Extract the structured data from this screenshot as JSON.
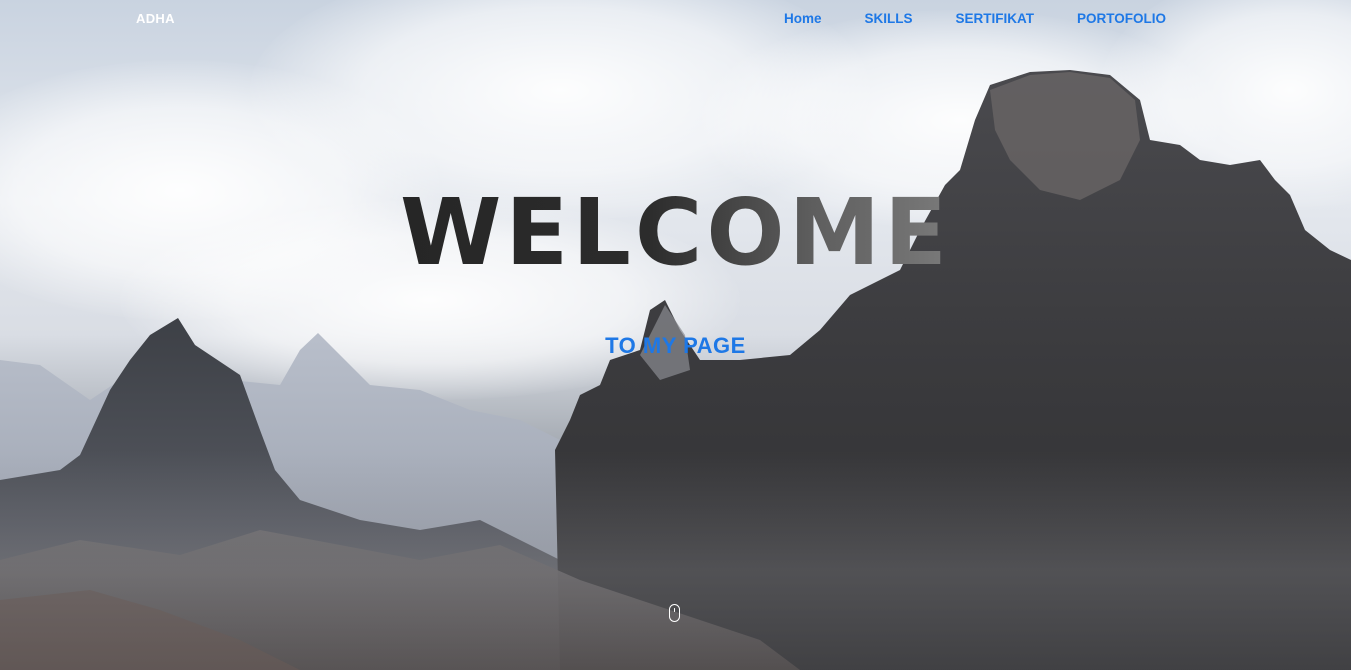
{
  "brand": {
    "name": "ADHA"
  },
  "nav": {
    "items": [
      {
        "label": "Home"
      },
      {
        "label": "SKILLS"
      },
      {
        "label": "SERTIFIKAT"
      },
      {
        "label": "PORTOFOLIO"
      }
    ]
  },
  "hero": {
    "title": "WELCOME",
    "subtitle": "TO MY PAGE",
    "scroll_icon": "mouse-scroll-icon"
  },
  "colors": {
    "nav_link": "#1e78e6",
    "brand": "#ffffff",
    "title": "#2a2a2a",
    "subtitle": "#1e78e6"
  }
}
